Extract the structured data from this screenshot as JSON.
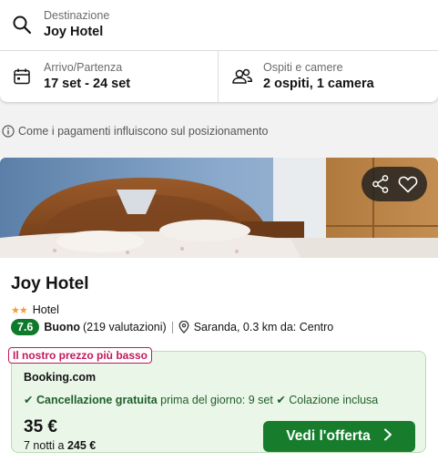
{
  "search": {
    "destination_label": "Destinazione",
    "destination_value": "Joy Hotel",
    "dates_label": "Arrivo/Partenza",
    "dates_value": "17 set - 24 set",
    "guests_label": "Ospiti e camere",
    "guests_value": "2 ospiti, 1 camera"
  },
  "info_note": "Come i pagamenti influiscono sul posizionamento",
  "hotel": {
    "name": "Joy Hotel",
    "stars": 2,
    "type": "Hotel",
    "score": "7.6",
    "rating_word": "Buono",
    "reviews": "(219 valutazioni)",
    "location": "Saranda, 0.3 km da: Centro"
  },
  "deal": {
    "badge": "Il nostro prezzo più basso",
    "provider": "Booking.com",
    "benefit1_strong": "Cancellazione gratuita",
    "benefit1_rest": "prima del giorno: 9 set",
    "benefit2": "Colazione inclusa",
    "price": "35 €",
    "total_prefix": "7 notti a",
    "total_amount": "245 €",
    "cta_label": "Vedi l'offerta"
  },
  "colors": {
    "accent_green": "#177d2d",
    "score_green": "#0f7a2c",
    "badge_pink": "#c2185b",
    "star_orange": "#f39c35"
  },
  "icons": {
    "destination": "search-icon",
    "dates": "calendar-icon",
    "guests": "users-icon",
    "info": "info-icon",
    "share": "share-icon",
    "favorite": "heart-icon",
    "location": "map-pin-icon",
    "cta": "chevron-right-icon"
  }
}
